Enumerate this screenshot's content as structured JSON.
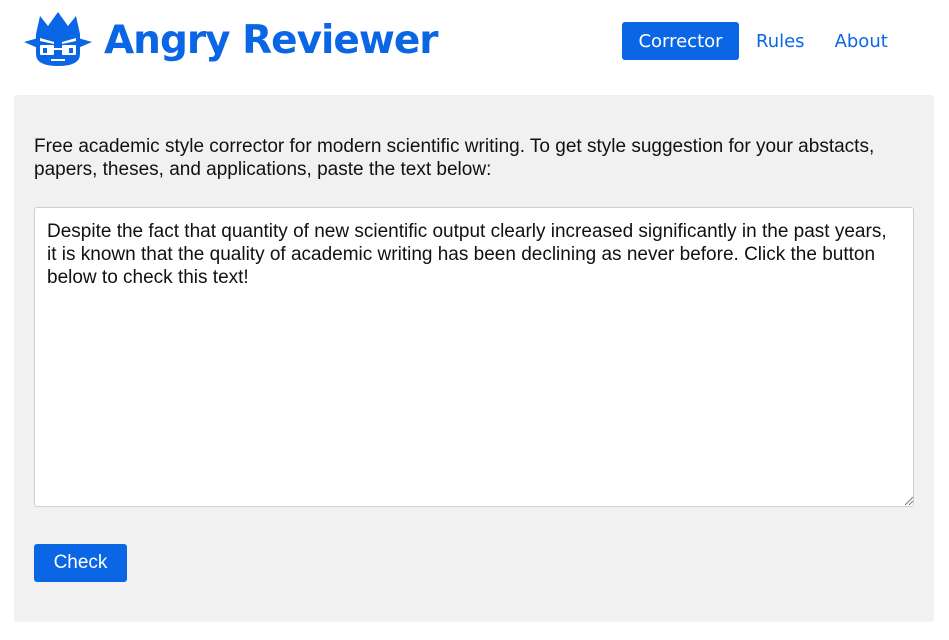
{
  "brand": {
    "name": "Angry Reviewer",
    "logo_icon": "angry-reviewer-logo-icon",
    "color": "#0a66e4"
  },
  "nav": {
    "items": [
      {
        "label": "Corrector",
        "active": true
      },
      {
        "label": "Rules",
        "active": false
      },
      {
        "label": "About",
        "active": false
      }
    ]
  },
  "main": {
    "intro": "Free academic style corrector for modern scientific writing. To get style suggestion for your abstacts, papers, theses, and applications, paste the text below:",
    "editor_text": "Despite the fact that quantity of new scientific output clearly increased significantly in the past years, it is known that the quality of academic writing has been declining as never before. Click the button below to check this text!",
    "check_label": "Check"
  },
  "colors": {
    "accent": "#0a66e4",
    "panel_bg": "#f1f1f1"
  }
}
